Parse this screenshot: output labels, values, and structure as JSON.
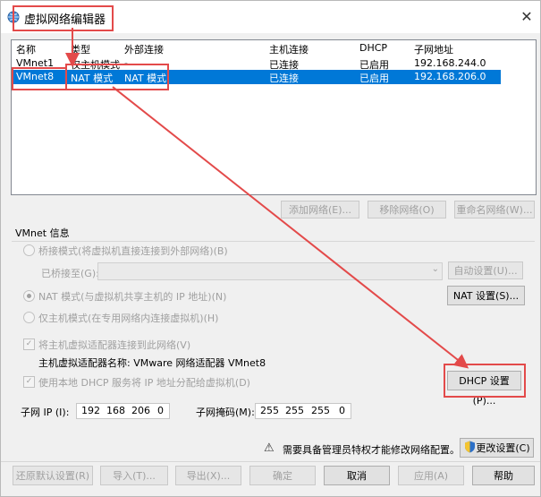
{
  "window": {
    "title": "虚拟网络编辑器",
    "close": "✕"
  },
  "table": {
    "headers": [
      "名称",
      "类型",
      "外部连接",
      "主机连接",
      "DHCP",
      "子网地址"
    ],
    "rows": [
      [
        "VMnet1",
        "仅主机模式",
        "-",
        "已连接",
        "已启用",
        "192.168.244.0"
      ],
      [
        "VMnet8",
        "NAT 模式",
        "NAT 模式",
        "已连接",
        "已启用",
        "192.168.206.0"
      ]
    ],
    "selected_index": 1
  },
  "network_buttons": {
    "add": "添加网络(E)...",
    "remove": "移除网络(O)",
    "rename": "重命名网络(W)..."
  },
  "vmnet_info": {
    "heading": "VMnet 信息",
    "bridged_label": "桥接模式(将虚拟机直接连接到外部网络)(B)",
    "bridged_to_label": "已桥接至(G):",
    "bridged_to_value": "",
    "auto_settings": "自动设置(U)...",
    "nat_label": "NAT 模式(与虚拟机共享主机的 IP 地址)(N)",
    "nat_settings": "NAT 设置(S)...",
    "hostonly_label": "仅主机模式(在专用网络内连接虚拟机)(H)",
    "connect_adapter_label": "将主机虚拟适配器连接到此网络(V)",
    "adapter_name_label": "主机虚拟适配器名称: VMware 网络适配器 VMnet8",
    "dhcp_label": "使用本地 DHCP 服务将 IP 地址分配给虚拟机(D)",
    "dhcp_settings": "DHCP 设置(P)...",
    "subnet_ip_label": "子网 IP (I):",
    "subnet_ip": [
      "192",
      "168",
      "206",
      "0"
    ],
    "subnet_mask_label": "子网掩码(M):",
    "subnet_mask": [
      "255",
      "255",
      "255",
      "0"
    ],
    "selected_mode": "nat",
    "connect_adapter_checked": true,
    "dhcp_checked": true
  },
  "admin": {
    "notice": "需要具备管理员特权才能修改网络配置。",
    "change_settings": "更改设置(C)"
  },
  "footer": {
    "restore_defaults": "还原默认设置(R)",
    "import": "导入(T)...",
    "export": "导出(X)...",
    "ok": "确定",
    "cancel": "取消",
    "apply": "应用(A)",
    "help": "帮助"
  },
  "colors": {
    "selection": "#0078d7",
    "annotation": "#e34a4a"
  }
}
